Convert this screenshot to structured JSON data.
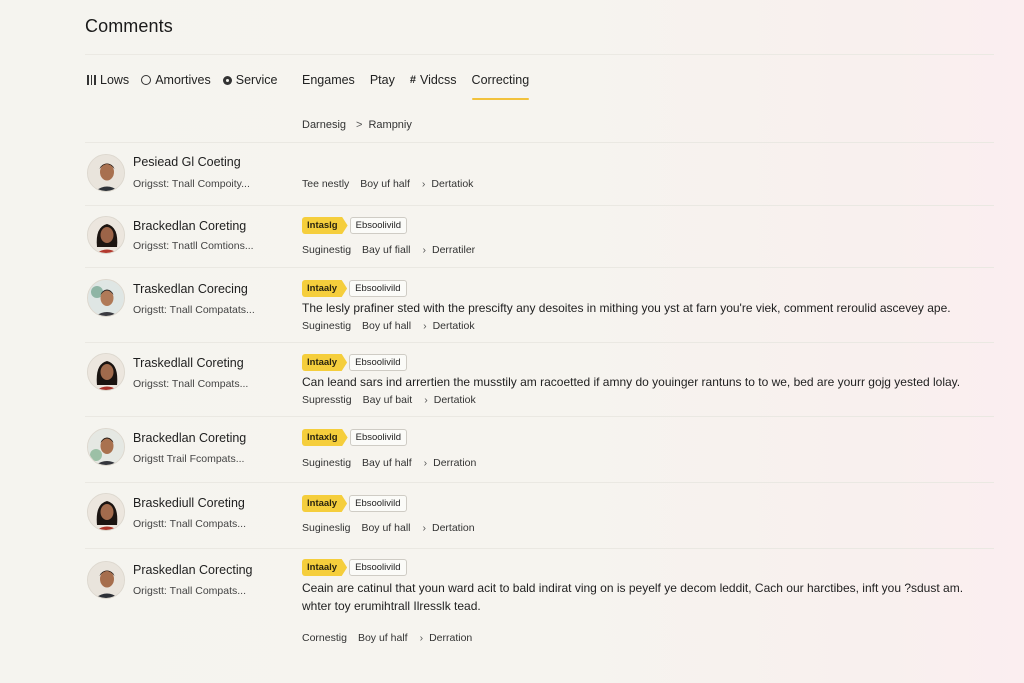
{
  "page_title": "Comments",
  "nav_left": [
    {
      "label": "Lows",
      "icon": "bars-icon"
    },
    {
      "label": "Amortives",
      "icon": "circle-icon"
    },
    {
      "label": "Service",
      "icon": "gear-icon"
    }
  ],
  "nav_right": [
    {
      "label": "Engames"
    },
    {
      "label": "Ptay"
    },
    {
      "label": "Vidcss",
      "prefix": "#"
    },
    {
      "label": "Correcting",
      "active": true
    }
  ],
  "breadcrumb": {
    "first": "Darnesig",
    "separator": ">",
    "second": "Rampniy"
  },
  "accent_color": "#f5ce3c",
  "comments": [
    {
      "name": "Pesiead Gl Coeting",
      "sub": "Origsst: Tnall Compoity...",
      "meta": {
        "a": "Tee nestly",
        "b": "Boy uf half",
        "c": "Dertatiok"
      }
    },
    {
      "name": "Brackedlan Coreting",
      "sub": "Origsst: Tnatll Comtions...",
      "tag_primary": "lntaslg",
      "tag_secondary": "Ebsoolivild",
      "meta": {
        "a": "Suginestig",
        "b": "Bay uf fiall",
        "c": "Derratiler"
      }
    },
    {
      "name": "Traskedlan Corecing",
      "sub": "Origstt: Tnall Compatats...",
      "tag_primary": "lntaaly",
      "tag_secondary": "Ebsoolivild",
      "body": "The lesly prafiner sted with the prescifty any desoites in mithing you yst at farn you're viek, comment reroulid ascevey ape.",
      "meta": {
        "a": "Suginestig",
        "b": "Boy uf hall",
        "c": "Dertatiok"
      }
    },
    {
      "name": "Traskedlall Coreting",
      "sub": "Origsst: Tnall Compats...",
      "tag_primary": "lntaaly",
      "tag_secondary": "Ebsoolivild",
      "body": "Can leand sars ind arrertien the musstily am racoetted if amny do youinger rantuns to to we, bed are yourr gojg yested lolay.",
      "meta": {
        "a": "Supresstig",
        "b": "Bay uf bait",
        "c": "Dertatiok"
      }
    },
    {
      "name": "Brackedlan Coreting",
      "sub": "Origstt Trail Fcompats...",
      "tag_primary": "lntaxlg",
      "tag_secondary": "Ebsoolivild",
      "meta": {
        "a": "Suginestig",
        "b": "Bay uf half",
        "c": "Derration"
      }
    },
    {
      "name": "Braskediull Coreting",
      "sub": "Origstt: Tnall Compats...",
      "tag_primary": "lntaaly",
      "tag_secondary": "Ebsoolivild",
      "meta": {
        "a": "Sugineslig",
        "b": "Boy uf hall",
        "c": "Dertation"
      }
    },
    {
      "name": "Praskedlan Corecting",
      "sub": "Origstt: Tnall Compats...",
      "tag_primary": "lntaaly",
      "tag_secondary": "Ebsoolivild",
      "body": "Ceain are catinul that youn ward acit to bald indirat ving on is peyelf ye decom leddit, Cach our harctibes, inft you ?sdust am.",
      "body2": "whter toy erumihtrall Ilresslk tead.",
      "meta": {
        "a": "Cornestig",
        "b": "Boy uf half",
        "c": "Derration"
      }
    }
  ]
}
